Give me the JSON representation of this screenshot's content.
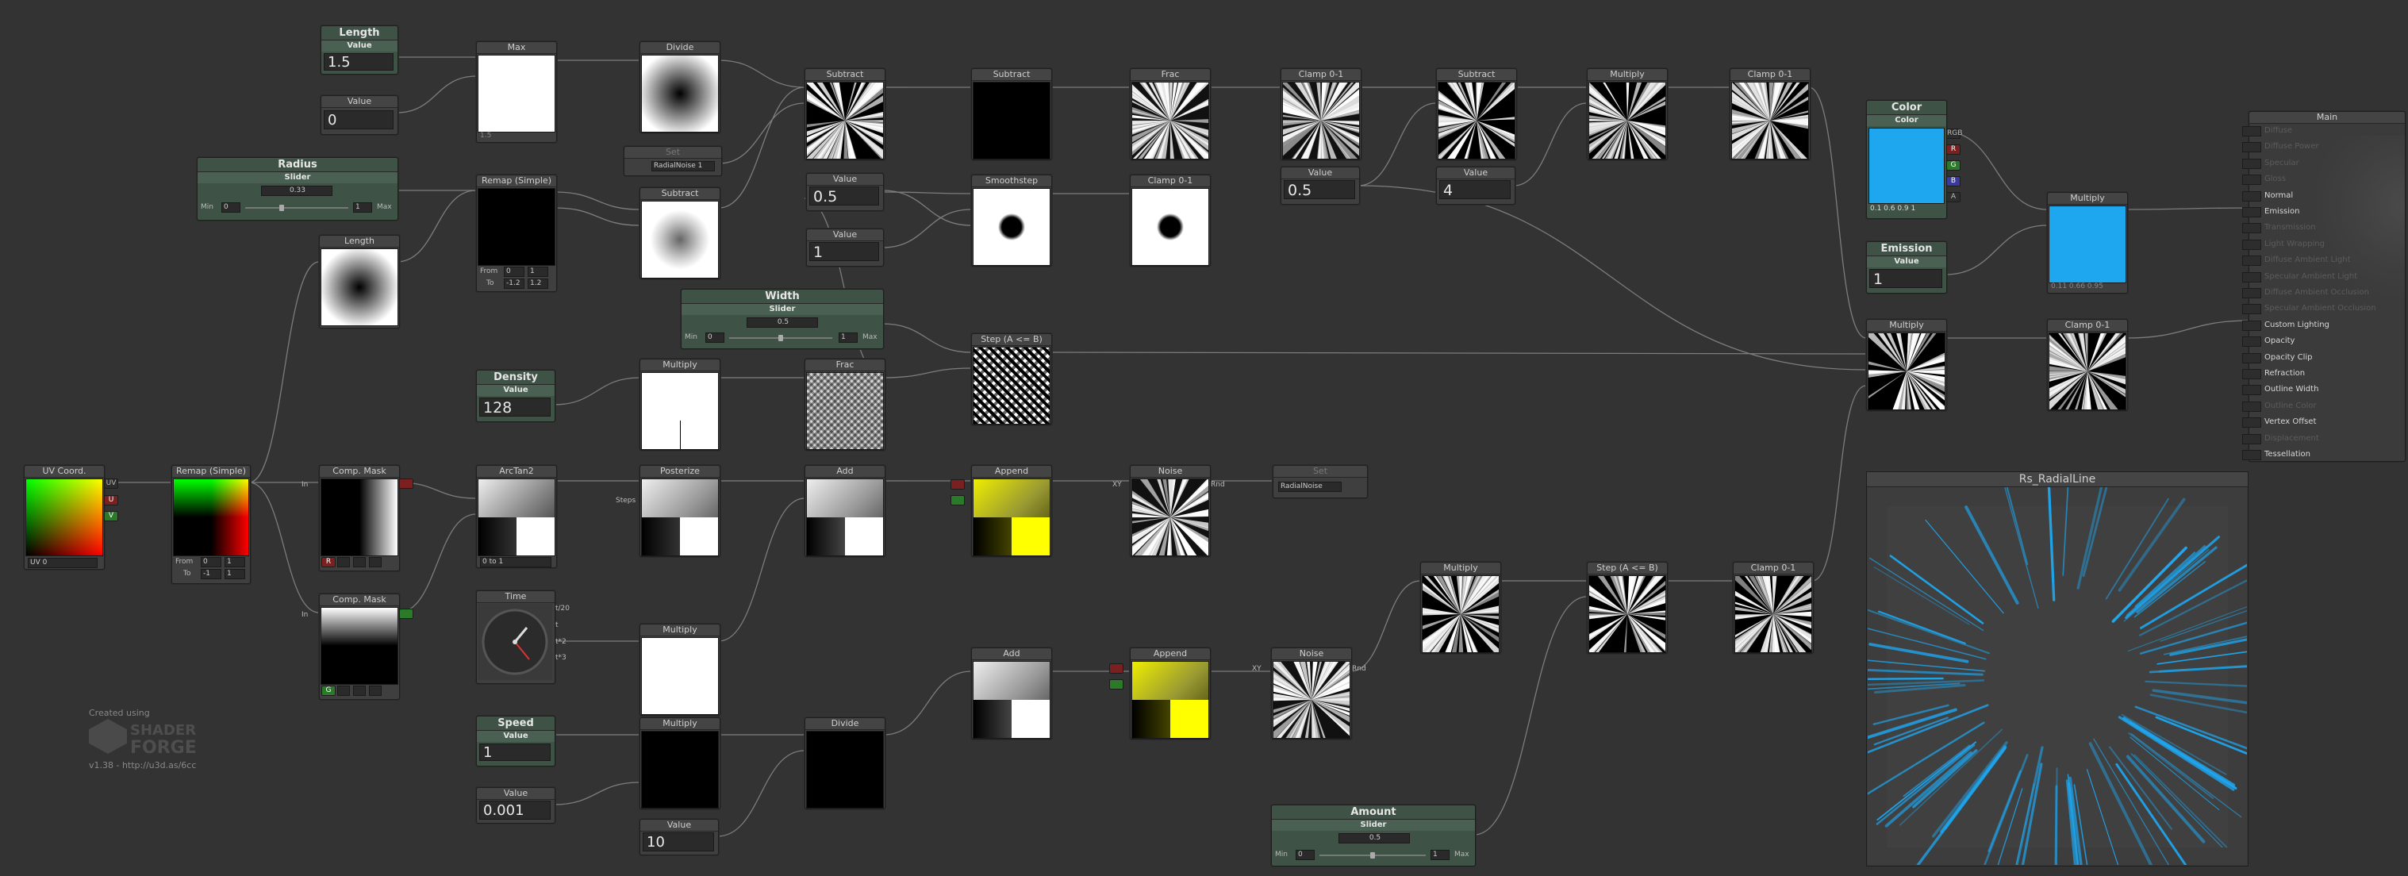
{
  "nodes": {
    "length_value": {
      "title": "Length",
      "sub": "Value",
      "value": "1.5"
    },
    "value_0": {
      "title": "Value",
      "value": "0"
    },
    "max": {
      "title": "Max",
      "below": "1.5"
    },
    "divide1": {
      "title": "Divide"
    },
    "set_radialnoise1": {
      "title": "Set",
      "value": "RadialNoise 1"
    },
    "subtract1": {
      "title": "Subtract"
    },
    "subtract2": {
      "title": "Subtract"
    },
    "frac1": {
      "title": "Frac"
    },
    "clamp1": {
      "title": "Clamp 0-1"
    },
    "subtract3": {
      "title": "Subtract"
    },
    "multiply1": {
      "title": "Multiply"
    },
    "clamp2": {
      "title": "Clamp 0-1"
    },
    "radius": {
      "title": "Radius",
      "sub": "Slider",
      "value": "0.33",
      "min_label": "Min",
      "min": "0",
      "max_label": "Max",
      "max": "1"
    },
    "remap1": {
      "title": "Remap (Simple)",
      "from_label": "From",
      "from_a": "0",
      "from_b": "1",
      "to_label": "To",
      "to_a": "-1.2",
      "to_b": "1.2"
    },
    "subtract4": {
      "title": "Subtract"
    },
    "value_05": {
      "title": "Value",
      "value": "0.5"
    },
    "value_1": {
      "title": "Value",
      "value": "1"
    },
    "smoothstep": {
      "title": "Smoothstep"
    },
    "clamp3": {
      "title": "Clamp 0-1"
    },
    "value_05b": {
      "title": "Value",
      "value": "0.5"
    },
    "value_4": {
      "title": "Value",
      "value": "4"
    },
    "length_node": {
      "title": "Length"
    },
    "width": {
      "title": "Width",
      "sub": "Slider",
      "value": "0.5",
      "min_label": "Min",
      "min": "0",
      "max_label": "Max",
      "max": "1"
    },
    "step1": {
      "title": "Step (A <= B)"
    },
    "density": {
      "title": "Density",
      "sub": "Value",
      "value": "128"
    },
    "multiply2": {
      "title": "Multiply"
    },
    "frac2": {
      "title": "Frac"
    },
    "uvcoord": {
      "title": "UV Coord.",
      "uv_label": "UV",
      "u_label": "U",
      "v_label": "V",
      "ch_label": "UV 0"
    },
    "remap2": {
      "title": "Remap (Simple)",
      "from_label": "From",
      "from_a": "0",
      "from_b": "1",
      "to_label": "To",
      "to_a": "-1",
      "to_b": "1"
    },
    "compmask1": {
      "title": "Comp. Mask",
      "in": "In",
      "ch": "R"
    },
    "arctan2": {
      "title": "ArcTan2",
      "below": "0 to 1"
    },
    "posterize": {
      "title": "Posterize",
      "steps": "Steps"
    },
    "add1": {
      "title": "Add"
    },
    "append1": {
      "title": "Append"
    },
    "noise1": {
      "title": "Noise",
      "xy": "XY",
      "rnd": "Rnd"
    },
    "set_radialnoise2": {
      "title": "Set",
      "value": "RadialNoise"
    },
    "compmask2": {
      "title": "Comp. Mask",
      "in": "In",
      "ch": "G"
    },
    "time": {
      "title": "Time",
      "t20": "t/20",
      "t": "t",
      "t2": "t*2",
      "t3": "t*3"
    },
    "multiply3": {
      "title": "Multiply"
    },
    "speed": {
      "title": "Speed",
      "sub": "Value",
      "value": "1"
    },
    "multiply4": {
      "title": "Multiply"
    },
    "divide2": {
      "title": "Divide"
    },
    "value_0001": {
      "title": "Value",
      "value": "0.001"
    },
    "value_10": {
      "title": "Value",
      "value": "10"
    },
    "add2": {
      "title": "Add"
    },
    "append2": {
      "title": "Append"
    },
    "noise2": {
      "title": "Noise",
      "xy": "XY",
      "rnd": "Rnd"
    },
    "multiply5": {
      "title": "Multiply"
    },
    "step2": {
      "title": "Step (A <= B)"
    },
    "clamp4": {
      "title": "Clamp 0-1"
    },
    "amount": {
      "title": "Amount",
      "sub": "Slider",
      "value": "0.5",
      "min_label": "Min",
      "min": "0",
      "max_label": "Max",
      "max": "1"
    },
    "color": {
      "title": "Color",
      "sub": "Color",
      "vals": "0.1  0.6  0.9  1",
      "rgb": "RGB",
      "r": "R",
      "g": "G",
      "b": "B",
      "a": "A"
    },
    "emission": {
      "title": "Emission",
      "sub": "Value",
      "value": "1"
    },
    "multiply6": {
      "title": "Multiply",
      "below": "0.11  0.66  0.95"
    },
    "multiply7": {
      "title": "Multiply"
    },
    "clamp5": {
      "title": "Clamp 0-1"
    }
  },
  "main": {
    "title": "Main",
    "rows": [
      {
        "label": "Diffuse",
        "on": false
      },
      {
        "label": "Diffuse Power",
        "on": false
      },
      {
        "label": "Specular",
        "on": false
      },
      {
        "label": "Gloss",
        "on": false
      },
      {
        "label": "Normal",
        "on": true
      },
      {
        "label": "Emission",
        "on": true
      },
      {
        "label": "Transmission",
        "on": false
      },
      {
        "label": "Light Wrapping",
        "on": false
      },
      {
        "label": "Diffuse Ambient Light",
        "on": false
      },
      {
        "label": "Specular Ambient Light",
        "on": false
      },
      {
        "label": "Diffuse Ambient Occlusion",
        "on": false
      },
      {
        "label": "Specular Ambient Occlusion",
        "on": false
      },
      {
        "label": "Custom Lighting",
        "on": true
      },
      {
        "label": "Opacity",
        "on": true
      },
      {
        "label": "Opacity Clip",
        "on": true
      },
      {
        "label": "Refraction",
        "on": true
      },
      {
        "label": "Outline Width",
        "on": true
      },
      {
        "label": "Outline Color",
        "on": false
      },
      {
        "label": "Vertex Offset",
        "on": true
      },
      {
        "label": "Displacement",
        "on": false
      },
      {
        "label": "Tessellation",
        "on": true
      }
    ]
  },
  "preview": {
    "title": "Rs_RadialLine"
  },
  "credits": {
    "created": "Created using",
    "logo_top": "SHADER",
    "logo_bottom": "FORGE",
    "version": "v1.38 - http://u3d.as/6cc"
  },
  "colors": {
    "background": "#333333",
    "node": "#3f3f3f",
    "property_node": "#3e5246",
    "accent_blue": "#1ea6ef",
    "yellow": "#e6d600"
  }
}
